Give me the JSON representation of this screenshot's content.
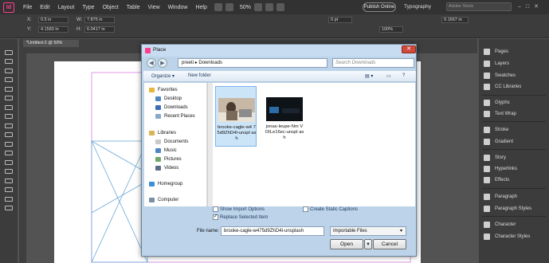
{
  "menubar": {
    "app_logo": "Id",
    "items": [
      "File",
      "Edit",
      "Layout",
      "Type",
      "Object",
      "Table",
      "View",
      "Window",
      "Help"
    ],
    "zoom": "50%",
    "publish": "Publish Online",
    "workspace": "Typography",
    "stock_search": "Adobe Stock"
  },
  "control": {
    "x_label": "X:",
    "x_value": "0.5 in",
    "y_label": "Y:",
    "y_value": "4.1583 in",
    "w_label": "W:",
    "w_value": "7.875 in",
    "h_label": "H:",
    "h_value": "6.0417 in",
    "stroke_value": "0 pt",
    "percent_value": "100%",
    "ref_value": "0.1667 in"
  },
  "document": {
    "tab_label": "*Untitled-2 @ 50%"
  },
  "panel": {
    "items": [
      "Pages",
      "Layers",
      "Swatches",
      "CC Libraries",
      "Glyphs",
      "Text Wrap",
      "Stroke",
      "Gradient",
      "Story",
      "Hyperlinks",
      "Effects",
      "Paragraph",
      "Paragraph Styles",
      "Character",
      "Character Styles"
    ]
  },
  "dialog": {
    "title": "Place",
    "close": "✕",
    "path": [
      "preeti",
      "Downloads"
    ],
    "search_placeholder": "Search Downloads",
    "organize": "Organize ▾",
    "new_folder": "New folder",
    "nav": {
      "favorites": "Favorites",
      "desktop": "Desktop",
      "downloads": "Downloads",
      "recent": "Recent Places",
      "libraries": "Libraries",
      "documents": "Documents",
      "music": "Music",
      "pictures": "Pictures",
      "videos": "Videos",
      "homegroup": "Homegroup",
      "computer": "Computer"
    },
    "files": [
      {
        "name": "brooke-cagle-w475d9ZhD4I-unsplash",
        "label": "brooke-cagle-w4 75d9ZhD4I-unspl ash"
      },
      {
        "name": "jonas-leupe-NmVOILe16ec-unsplash",
        "label": "jonas-leupe-Nm VOILe16ec-unspl ash"
      }
    ],
    "show_import": "Show Import Options",
    "create_static": "Create Static Captions",
    "replace_selected": "Replace Selected Item",
    "replace_checked": "✓",
    "file_name_label": "File name:",
    "file_name_value": "brooke-cagle-w475d9ZhD4I-unsplash",
    "filter": "Importable Files",
    "open": "Open",
    "cancel": "Cancel"
  }
}
